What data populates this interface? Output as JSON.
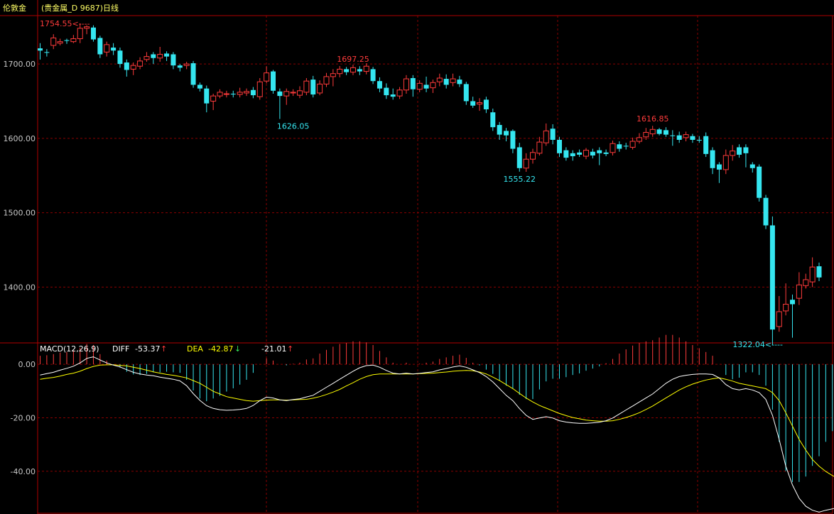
{
  "header": {
    "title": "伦敦金",
    "subtitle": "(贵金属_D 9687)日线"
  },
  "colors": {
    "background": "#000000",
    "frame": "#b00000",
    "grid": "#8a0000",
    "up": "#ff3b3b",
    "down": "#35e6f0",
    "axis_text": "#c8c8c8",
    "diff": "#ffffff",
    "dea": "#ffff00",
    "title": "#ffff66"
  },
  "price_axis": {
    "ticks": [
      "1700.00",
      "1600.00",
      "1500.00",
      "1400.00"
    ],
    "tick_values": [
      1700,
      1600,
      1500,
      1400
    ],
    "ylim": [
      1325,
      1765
    ]
  },
  "macd_axis": {
    "ticks": [
      "0.00",
      "-20.00",
      "-40.00"
    ],
    "tick_values": [
      0,
      -20,
      -40
    ],
    "ylim": [
      -56,
      8
    ]
  },
  "annotations": {
    "high_label": "1754.55",
    "high_value": 1754.55,
    "low_label": "1322.04",
    "low_value": 1322.04,
    "marks": [
      {
        "text": "1697.25",
        "value": 1697.25,
        "bar": 47,
        "pos": "above",
        "color": "#ff3b3b"
      },
      {
        "text": "1626.05",
        "value": 1626.05,
        "bar": 38,
        "pos": "below",
        "color": "#35e6f0"
      },
      {
        "text": "1555.22",
        "value": 1555.22,
        "bar": 72,
        "pos": "below",
        "color": "#35e6f0"
      },
      {
        "text": "1616.85",
        "value": 1616.85,
        "bar": 92,
        "pos": "above",
        "color": "#ff3b3b"
      }
    ]
  },
  "macd_legend": {
    "name": "MACD(12,26,9)",
    "diff_label": "DIFF",
    "diff_value": "-53.37",
    "diff_arrow": "↑",
    "dea_label": "DEA",
    "dea_value": "-42.87",
    "dea_arrow": "↓",
    "macd_value": "-21.01",
    "macd_arrow": "↑"
  },
  "chart_data": {
    "type": "candlestick",
    "candles": [
      [
        1721,
        1718,
        1728,
        1706
      ],
      [
        1716,
        1715,
        1720,
        1710
      ],
      [
        1725,
        1735,
        1740,
        1720
      ],
      [
        1728,
        1730,
        1734,
        1725
      ],
      [
        1732,
        1731,
        1734,
        1727
      ],
      [
        1730,
        1734,
        1739,
        1728
      ],
      [
        1734,
        1748,
        1754.55,
        1728
      ],
      [
        1748,
        1750,
        1752,
        1740
      ],
      [
        1749,
        1733,
        1752,
        1730
      ],
      [
        1735,
        1713,
        1738,
        1708
      ],
      [
        1716,
        1726,
        1730,
        1710
      ],
      [
        1722,
        1718,
        1728,
        1712
      ],
      [
        1718,
        1700,
        1722,
        1695
      ],
      [
        1702,
        1692,
        1706,
        1683
      ],
      [
        1693,
        1698,
        1702,
        1685
      ],
      [
        1697,
        1704,
        1709,
        1693
      ],
      [
        1706,
        1710,
        1716,
        1703
      ],
      [
        1713,
        1708,
        1716,
        1700
      ],
      [
        1708,
        1713,
        1723,
        1703
      ],
      [
        1714,
        1710,
        1717,
        1704
      ],
      [
        1713,
        1698,
        1716,
        1693
      ],
      [
        1698,
        1695,
        1700,
        1690
      ],
      [
        1698,
        1700,
        1703,
        1693
      ],
      [
        1701,
        1672,
        1704,
        1668
      ],
      [
        1672,
        1667,
        1675,
        1663
      ],
      [
        1667,
        1647,
        1671,
        1635
      ],
      [
        1650,
        1657,
        1660,
        1638
      ],
      [
        1657,
        1662,
        1666,
        1654
      ],
      [
        1660,
        1660,
        1664,
        1655
      ],
      [
        1660,
        1659,
        1664,
        1655
      ],
      [
        1659,
        1662,
        1668,
        1655
      ],
      [
        1661,
        1663,
        1667,
        1657
      ],
      [
        1665,
        1658,
        1669,
        1654
      ],
      [
        1656,
        1676,
        1681,
        1652
      ],
      [
        1677,
        1688,
        1697,
        1674
      ],
      [
        1690,
        1664,
        1692,
        1660
      ],
      [
        1663,
        1657,
        1667,
        1626.05
      ],
      [
        1657,
        1663,
        1667,
        1645
      ],
      [
        1661,
        1662,
        1666,
        1657
      ],
      [
        1658,
        1664,
        1670,
        1654
      ],
      [
        1662,
        1677,
        1681,
        1658
      ],
      [
        1679,
        1659,
        1684,
        1655
      ],
      [
        1661,
        1673,
        1678,
        1658
      ],
      [
        1673,
        1683,
        1688,
        1669
      ],
      [
        1683,
        1687,
        1693,
        1670
      ],
      [
        1687,
        1693,
        1697.25,
        1682
      ],
      [
        1693,
        1689,
        1696,
        1685
      ],
      [
        1689,
        1695,
        1699,
        1685
      ],
      [
        1693,
        1690,
        1697,
        1685
      ],
      [
        1690,
        1697,
        1701,
        1686
      ],
      [
        1693,
        1677,
        1696,
        1673
      ],
      [
        1677,
        1667,
        1682,
        1662
      ],
      [
        1668,
        1658,
        1674,
        1653
      ],
      [
        1659,
        1656,
        1667,
        1652
      ],
      [
        1657,
        1665,
        1669,
        1653
      ],
      [
        1665,
        1680,
        1685,
        1660
      ],
      [
        1681,
        1666,
        1685,
        1656
      ],
      [
        1666,
        1674,
        1678,
        1662
      ],
      [
        1672,
        1667,
        1683,
        1662
      ],
      [
        1668,
        1675,
        1679,
        1661
      ],
      [
        1676,
        1681,
        1687,
        1670
      ],
      [
        1680,
        1672,
        1686,
        1667
      ],
      [
        1675,
        1680,
        1687,
        1670
      ],
      [
        1679,
        1673,
        1684,
        1669
      ],
      [
        1673,
        1650,
        1676,
        1645
      ],
      [
        1650,
        1644,
        1656,
        1641
      ],
      [
        1646,
        1648,
        1654,
        1637
      ],
      [
        1652,
        1639,
        1656,
        1634
      ],
      [
        1635,
        1615,
        1640,
        1610
      ],
      [
        1618,
        1605,
        1622,
        1598
      ],
      [
        1610,
        1604,
        1614,
        1596
      ],
      [
        1610,
        1586,
        1612,
        1580
      ],
      [
        1588,
        1560,
        1594,
        1555.22
      ],
      [
        1560,
        1572,
        1580,
        1555
      ],
      [
        1572,
        1581,
        1586,
        1566
      ],
      [
        1580,
        1595,
        1602,
        1577
      ],
      [
        1594,
        1610,
        1620,
        1590
      ],
      [
        1613,
        1598,
        1619,
        1592
      ],
      [
        1598,
        1580,
        1602,
        1575
      ],
      [
        1584,
        1574,
        1588,
        1570
      ],
      [
        1580,
        1576,
        1584,
        1570
      ],
      [
        1581,
        1578,
        1585,
        1575
      ],
      [
        1576,
        1584,
        1587,
        1572
      ],
      [
        1582,
        1577,
        1586,
        1573
      ],
      [
        1584,
        1580,
        1588,
        1564
      ],
      [
        1581,
        1579,
        1585,
        1576
      ],
      [
        1581,
        1593,
        1597,
        1577
      ],
      [
        1592,
        1586,
        1596,
        1582
      ],
      [
        1590,
        1589,
        1594,
        1585
      ],
      [
        1588,
        1596,
        1601,
        1585
      ],
      [
        1596,
        1601,
        1607,
        1593
      ],
      [
        1602,
        1608,
        1614,
        1598
      ],
      [
        1606,
        1612,
        1616.85,
        1602
      ],
      [
        1612,
        1606,
        1614,
        1604
      ],
      [
        1611,
        1605,
        1615,
        1602
      ],
      [
        1604,
        1603,
        1611,
        1590
      ],
      [
        1604,
        1598,
        1609,
        1594
      ],
      [
        1601,
        1605,
        1609,
        1596
      ],
      [
        1603,
        1598,
        1606,
        1594
      ],
      [
        1598,
        1597,
        1603,
        1594
      ],
      [
        1603,
        1579,
        1608,
        1575
      ],
      [
        1584,
        1560,
        1588,
        1552
      ],
      [
        1565,
        1558,
        1568,
        1540
      ],
      [
        1558,
        1577,
        1585,
        1552
      ],
      [
        1577,
        1583,
        1591,
        1570
      ],
      [
        1588,
        1578,
        1592,
        1574
      ],
      [
        1588,
        1580,
        1592,
        1561
      ],
      [
        1565,
        1560,
        1568,
        1554
      ],
      [
        1562,
        1520,
        1565,
        1515
      ],
      [
        1520,
        1483,
        1524,
        1478
      ],
      [
        1483,
        1343,
        1495,
        1322.04
      ],
      [
        1347,
        1367,
        1388,
        1340
      ],
      [
        1368,
        1377,
        1405,
        1362
      ],
      [
        1383,
        1377,
        1390,
        1332
      ],
      [
        1385,
        1403,
        1420,
        1376
      ],
      [
        1402,
        1410,
        1418,
        1398
      ],
      [
        1407,
        1427,
        1440,
        1400
      ],
      [
        1428,
        1413,
        1433,
        1408
      ]
    ],
    "diff": [
      -4,
      -3.5,
      -3,
      -2.2,
      -1.5,
      -0.7,
      0.5,
      2.2,
      2.8,
      1.6,
      0.5,
      -0.3,
      -1,
      -2,
      -3,
      -3.6,
      -4,
      -4.3,
      -4.8,
      -5.2,
      -5.6,
      -6.2,
      -8,
      -11,
      -13.5,
      -15.5,
      -16.5,
      -17,
      -17.2,
      -17.1,
      -16.9,
      -16.5,
      -15.4,
      -13.6,
      -12.3,
      -12.6,
      -13.3,
      -13.6,
      -13.2,
      -12.9,
      -12.2,
      -11.6,
      -10.1,
      -8.6,
      -7.1,
      -5.6,
      -4.1,
      -2.6,
      -1.3,
      -0.5,
      -0.3,
      -1.1,
      -2.3,
      -3.3,
      -3.6,
      -3.3,
      -3.6,
      -3.4,
      -3.1,
      -2.8,
      -2.1,
      -1.6,
      -1,
      -0.6,
      -1.1,
      -2.1,
      -3.1,
      -4.6,
      -6.6,
      -9.1,
      -11.6,
      -13.6,
      -16.6,
      -19.1,
      -20.6,
      -20.1,
      -19.6,
      -20.1,
      -21.1,
      -21.6,
      -21.9,
      -22.1,
      -22.1,
      -21.9,
      -21.7,
      -21.1,
      -20.1,
      -18.6,
      -17.1,
      -15.6,
      -14.1,
      -12.6,
      -11.1,
      -9.1,
      -7.1,
      -5.6,
      -4.6,
      -4.1,
      -3.8,
      -3.6,
      -3.6,
      -3.8,
      -5.1,
      -7.6,
      -9.1,
      -9.6,
      -9.1,
      -9.6,
      -10.6,
      -13.1,
      -19.1,
      -28.1,
      -38.1,
      -45.1,
      -50.1,
      -53.1,
      -54.6,
      -55.3,
      -54.6,
      -54.1,
      -53.37
    ],
    "dea": [
      -5.6,
      -5.2,
      -4.9,
      -4.4,
      -3.8,
      -3.3,
      -2.6,
      -1.6,
      -0.8,
      -0.3,
      -0.2,
      -0.2,
      -0.4,
      -0.6,
      -1.1,
      -1.6,
      -2.2,
      -2.8,
      -3.3,
      -3.8,
      -4.1,
      -4.6,
      -5.1,
      -6.1,
      -7.1,
      -8.6,
      -10.1,
      -11.1,
      -12.1,
      -12.6,
      -13.1,
      -13.6,
      -13.8,
      -13.6,
      -13.4,
      -13.3,
      -13.3,
      -13.4,
      -13.3,
      -13.2,
      -13.1,
      -12.7,
      -12.1,
      -11.3,
      -10.4,
      -9.4,
      -8.1,
      -6.9,
      -5.6,
      -4.6,
      -3.9,
      -3.6,
      -3.6,
      -3.6,
      -3.6,
      -3.6,
      -3.6,
      -3.5,
      -3.4,
      -3.3,
      -3.1,
      -2.9,
      -2.6,
      -2.4,
      -2.3,
      -2.4,
      -2.9,
      -3.6,
      -4.8,
      -6.1,
      -7.6,
      -9.1,
      -10.9,
      -12.6,
      -14.1,
      -15.4,
      -16.4,
      -17.4,
      -18.4,
      -19.2,
      -19.9,
      -20.4,
      -20.9,
      -21.1,
      -21.3,
      -21.3,
      -21.1,
      -20.6,
      -19.9,
      -19.1,
      -18.1,
      -16.9,
      -15.6,
      -14.1,
      -12.6,
      -11.1,
      -9.6,
      -8.4,
      -7.4,
      -6.6,
      -5.9,
      -5.4,
      -5.1,
      -5.6,
      -6.3,
      -7.1,
      -7.6,
      -8.1,
      -8.6,
      -9.1,
      -10.6,
      -13.6,
      -18.1,
      -23.1,
      -28.1,
      -32.1,
      -35.6,
      -38.1,
      -40.1,
      -41.6,
      -42.87
    ]
  }
}
